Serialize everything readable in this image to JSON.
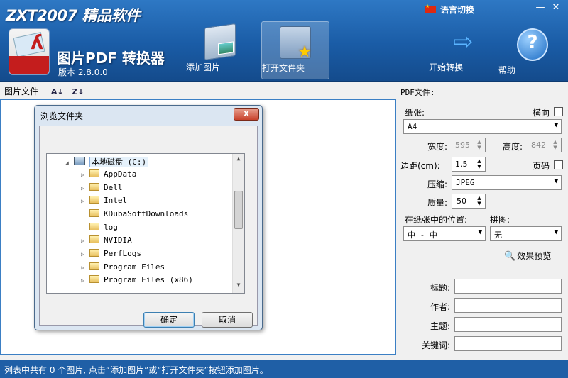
{
  "header": {
    "brand": "ZXT2007 精品软件",
    "app_title": "图片PDF 转换器",
    "version": "版本 2.8.0.0",
    "language_switch": "语言切换",
    "toolbar": {
      "add_image": "添加图片",
      "open_folder": "打开文件夹",
      "start_convert": "开始转换",
      "help": "帮助"
    }
  },
  "left_panel": {
    "header_label": "图片文件"
  },
  "right_panel": {
    "pdf_file_label": "PDF文件:",
    "paper_label": "纸张:",
    "landscape_label": "横向",
    "paper_value": "A4",
    "width_label": "宽度:",
    "width_value": "595",
    "height_label": "高度:",
    "height_value": "842",
    "margin_label": "边距(cm):",
    "margin_value": "1.5",
    "page_number_label": "页码",
    "compression_label": "压缩:",
    "compression_value": "JPEG",
    "quality_label": "质量:",
    "quality_value": "50",
    "position_label": "在纸张中的位置:",
    "position_value": "中 - 中",
    "collage_label": "拼图:",
    "collage_value": "无",
    "preview_label": "效果预览",
    "title_label": "标题:",
    "author_label": "作者:",
    "subject_label": "主题:",
    "keywords_label": "关键词:"
  },
  "status_bar": "列表中共有 0 个图片, 点击“添加图片”或“打开文件夹”按钮添加图片。",
  "dialog": {
    "title": "浏览文件夹",
    "close": "X",
    "root": "本地磁盘 (C:)",
    "folders": [
      "AppData",
      "Dell",
      "Intel",
      "KDubaSoftDownloads",
      "log",
      "NVIDIA",
      "PerfLogs",
      "Program Files",
      "Program Files (x86)"
    ],
    "ok": "确定",
    "cancel": "取消"
  },
  "colors": {
    "header_blue": "#1a5ca6",
    "status_blue": "#1f5fa6",
    "list_border": "#3b7fc4"
  }
}
